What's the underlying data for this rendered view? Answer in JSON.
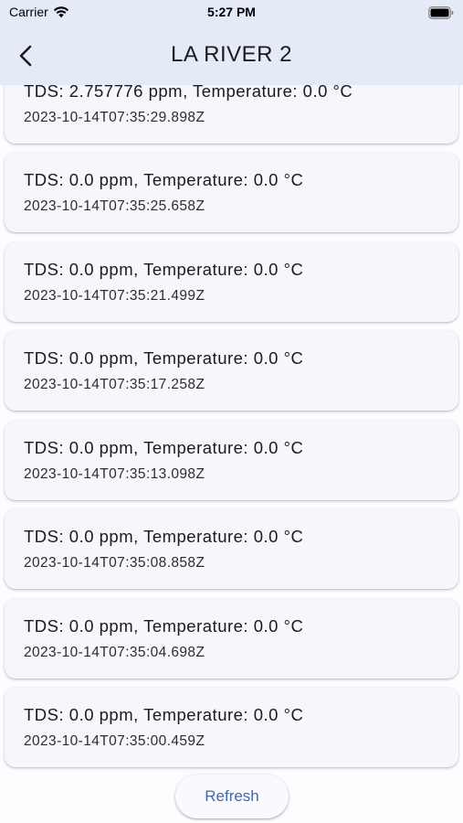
{
  "status_bar": {
    "carrier": "Carrier",
    "time": "5:27 PM"
  },
  "app_bar": {
    "title": "LA RIVER 2",
    "back_icon": "chevron-left-icon"
  },
  "readings": [
    {
      "title": "TDS: 2.757776 ppm, Temperature: 0.0 °C",
      "timestamp": "2023-10-14T07:35:29.898Z"
    },
    {
      "title": "TDS: 0.0 ppm, Temperature: 0.0 °C",
      "timestamp": "2023-10-14T07:35:25.658Z"
    },
    {
      "title": "TDS: 0.0 ppm, Temperature: 0.0 °C",
      "timestamp": "2023-10-14T07:35:21.499Z"
    },
    {
      "title": "TDS: 0.0 ppm, Temperature: 0.0 °C",
      "timestamp": "2023-10-14T07:35:17.258Z"
    },
    {
      "title": "TDS: 0.0 ppm, Temperature: 0.0 °C",
      "timestamp": "2023-10-14T07:35:13.098Z"
    },
    {
      "title": "TDS: 0.0 ppm, Temperature: 0.0 °C",
      "timestamp": "2023-10-14T07:35:08.858Z"
    },
    {
      "title": "TDS: 0.0 ppm, Temperature: 0.0 °C",
      "timestamp": "2023-10-14T07:35:04.698Z"
    },
    {
      "title": "TDS: 0.0 ppm, Temperature: 0.0 °C",
      "timestamp": "2023-10-14T07:35:00.459Z"
    }
  ],
  "actions": {
    "refresh_label": "Refresh"
  },
  "colors": {
    "app_bar_bg": "#e4ebf7",
    "card_bg": "#f6f6fc",
    "accent": "#3f6aa8"
  }
}
